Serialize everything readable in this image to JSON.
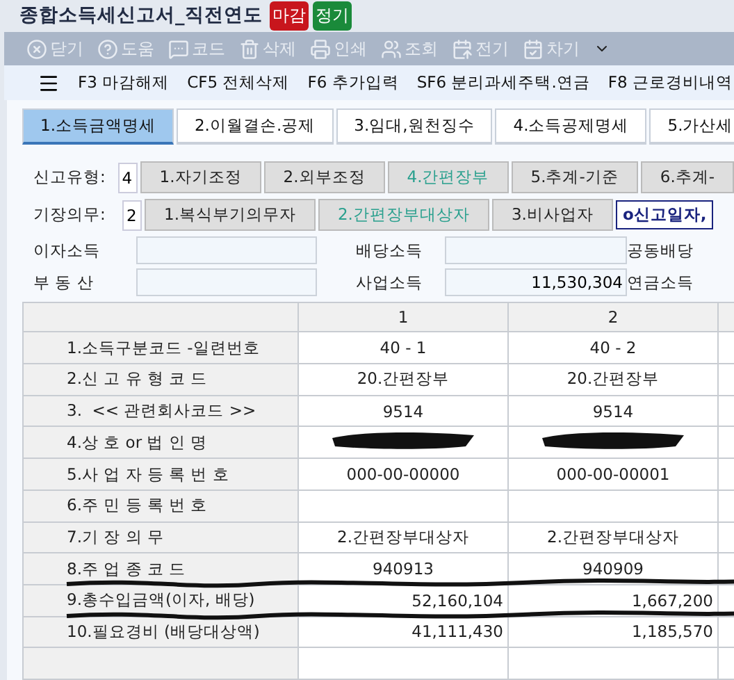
{
  "window": {
    "title": "종합소득세신고서_직전연도",
    "badges": [
      {
        "label": "마감",
        "color": "#c8161d"
      },
      {
        "label": "정기",
        "color": "#1a8a3a"
      }
    ]
  },
  "toolbar": [
    {
      "label": "닫기"
    },
    {
      "label": "도움"
    },
    {
      "label": "코드"
    },
    {
      "label": "삭제"
    },
    {
      "label": "인쇄"
    },
    {
      "label": "조회"
    },
    {
      "label": "전기"
    },
    {
      "label": "차기"
    }
  ],
  "function_bar": [
    {
      "key": "F3",
      "label": "마감해제"
    },
    {
      "key": "CF5",
      "label": "전체삭제"
    },
    {
      "key": "F6",
      "label": "추가입력"
    },
    {
      "key": "SF6",
      "label": "분리과세주택.연금"
    },
    {
      "key": "F8",
      "label": "근로경비내역"
    }
  ],
  "tabs": [
    {
      "label": "1.소득금액명세",
      "selected": true
    },
    {
      "label": "2.이월결손.공제",
      "selected": false
    },
    {
      "label": "3.임대,원천징수",
      "selected": false
    },
    {
      "label": "4.소득공제명세",
      "selected": false
    },
    {
      "label": "5.가산세",
      "selected": false
    }
  ],
  "option_rows": [
    {
      "label": "신고유형:",
      "value": "4",
      "options": [
        {
          "label": "1.자기조정",
          "selected": false
        },
        {
          "label": "2.외부조정",
          "selected": false
        },
        {
          "label": "4.간편장부",
          "selected": true
        },
        {
          "label": "5.추계-기준",
          "selected": false
        },
        {
          "label": "6.추계-",
          "selected": false
        }
      ]
    },
    {
      "label": "기장의무:",
      "value": "2",
      "options": [
        {
          "label": "1.복식부기의무자",
          "selected": false
        },
        {
          "label": "2.간편장부대상자",
          "selected": true
        },
        {
          "label": "3.비사업자",
          "selected": false
        }
      ],
      "note": "o신고일자,"
    }
  ],
  "income_fields": [
    {
      "label": "이자소득"
    },
    {
      "label": "배당소득"
    },
    {
      "label": "공동배당"
    },
    {
      "label": "부 동 산"
    },
    {
      "label": "사업소득",
      "value": "11,530,304"
    },
    {
      "label": "연금소득"
    }
  ],
  "table": {
    "columns": [
      "1",
      "2"
    ],
    "rows": [
      {
        "label": "1.소득구분코드 -일련번호",
        "kind": "text",
        "values": [
          "40 - 1",
          "40 - 2"
        ]
      },
      {
        "label": "2.신 고 유 형 코 드",
        "kind": "text",
        "values": [
          "20.간편장부",
          "20.간편장부"
        ]
      },
      {
        "label": "3.  << 관련회사코드 >>",
        "kind": "text",
        "values": [
          "9514",
          "9514"
        ]
      },
      {
        "label": "4.상 호 or 법 인 명",
        "kind": "redacted"
      },
      {
        "label": "5.사 업 자 등 록 번 호",
        "kind": "text",
        "values": [
          "000-00-00000",
          "000-00-00001"
        ]
      },
      {
        "label": "6.주 민 등 록 번 호",
        "kind": "text",
        "values": []
      },
      {
        "label": "7.기 장 의 무",
        "kind": "text",
        "values": [
          "2.간편장부대상자",
          "2.간편장부대상자"
        ]
      },
      {
        "label": "8.주 업 종 코 드",
        "kind": "text",
        "values": [
          "940913",
          "940909"
        ],
        "underlined": true
      },
      {
        "label": "9.총수입금액(이자, 배당)",
        "kind": "amount",
        "values": [
          "52,160,104",
          "1,667,200"
        ],
        "underlined": true
      },
      {
        "label": "10.필요경비 (배당대상액)",
        "kind": "amount",
        "values": [
          "41,111,430",
          "1,185,570"
        ]
      }
    ]
  }
}
